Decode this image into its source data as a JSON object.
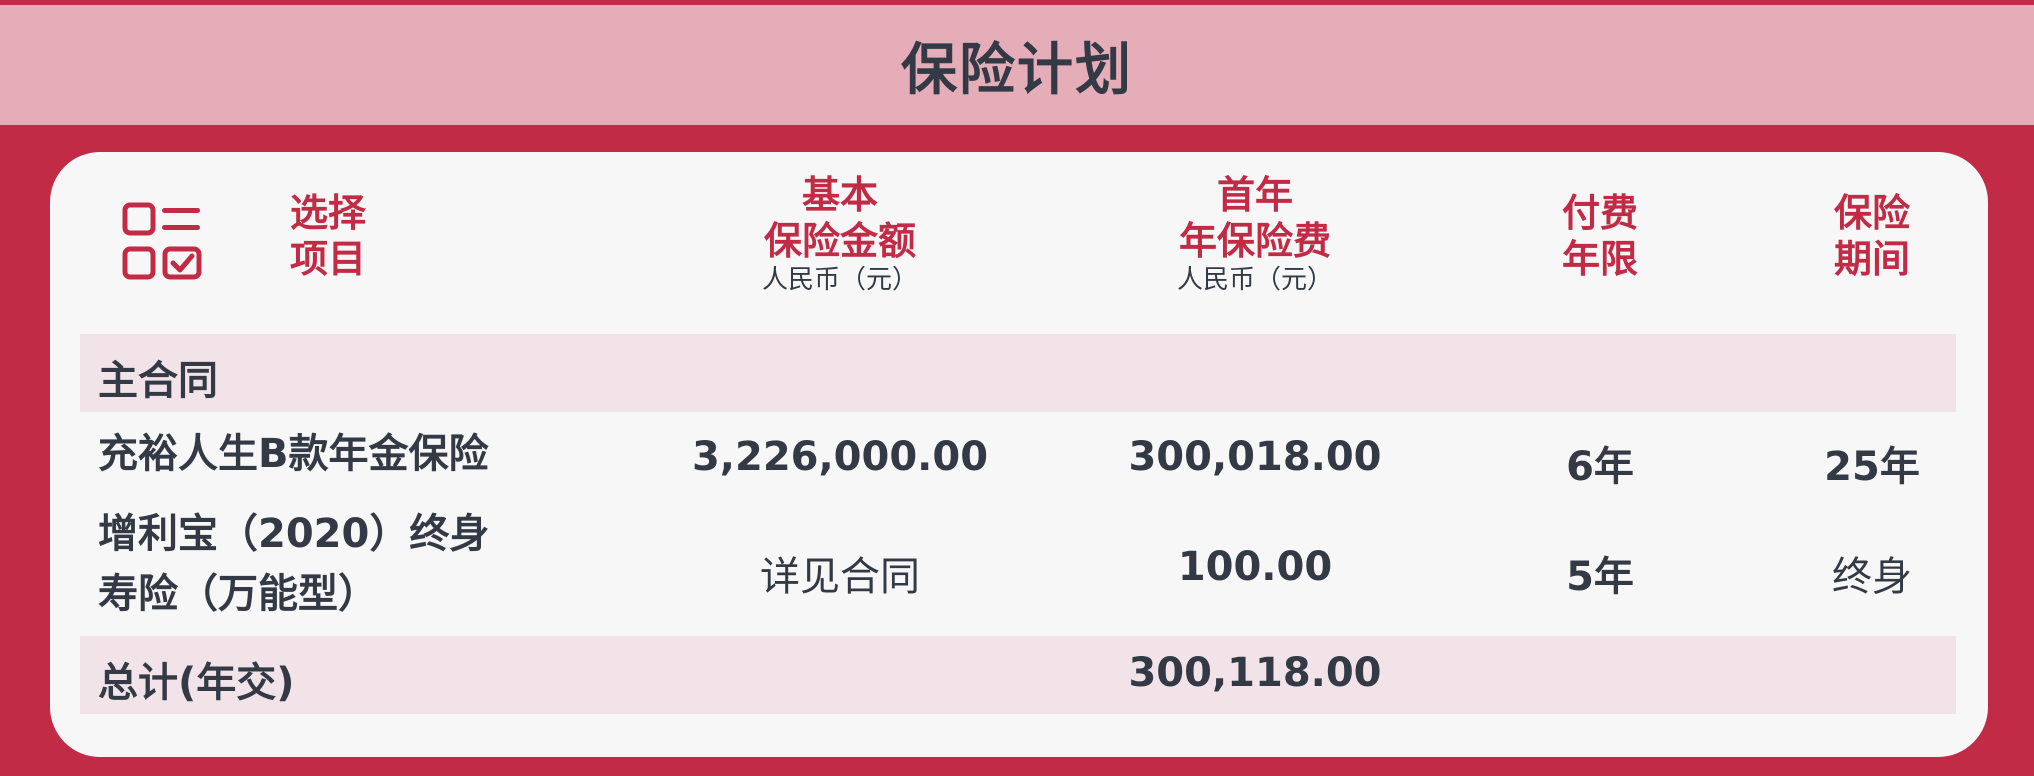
{
  "title": "保险计划",
  "header": {
    "select_line1": "选择",
    "select_line2": "项目",
    "sum_assured_line1": "基本",
    "sum_assured_line2": "保险金额",
    "sum_assured_unit": "人民币（元）",
    "premium_line1": "首年",
    "premium_line2": "年保险费",
    "premium_unit": "人民币（元）",
    "pay_term_line1": "付费",
    "pay_term_line2": "年限",
    "coverage_line1": "保险",
    "coverage_line2": "期间"
  },
  "sections": {
    "main_contract": "主合同",
    "total_label": "总计(年交)",
    "total_premium": "300,118.00"
  },
  "rows": [
    {
      "name": "充裕人生B款年金保险",
      "sum_assured": "3,226,000.00",
      "premium": "300,018.00",
      "pay_term": "6年",
      "coverage": "25年"
    },
    {
      "name_line1": "增利宝（2020）终身",
      "name_line2": "寿险（万能型）",
      "sum_assured": "详见合同",
      "premium": "100.00",
      "pay_term": "5年",
      "coverage": "终身"
    }
  ],
  "icons": {
    "select": "checklist-icon"
  },
  "colors": {
    "brand_red": "#c12b46",
    "title_bar_pink": "#e4adb8",
    "band_pink": "#f1e3e7",
    "text_dark": "#333a45"
  }
}
